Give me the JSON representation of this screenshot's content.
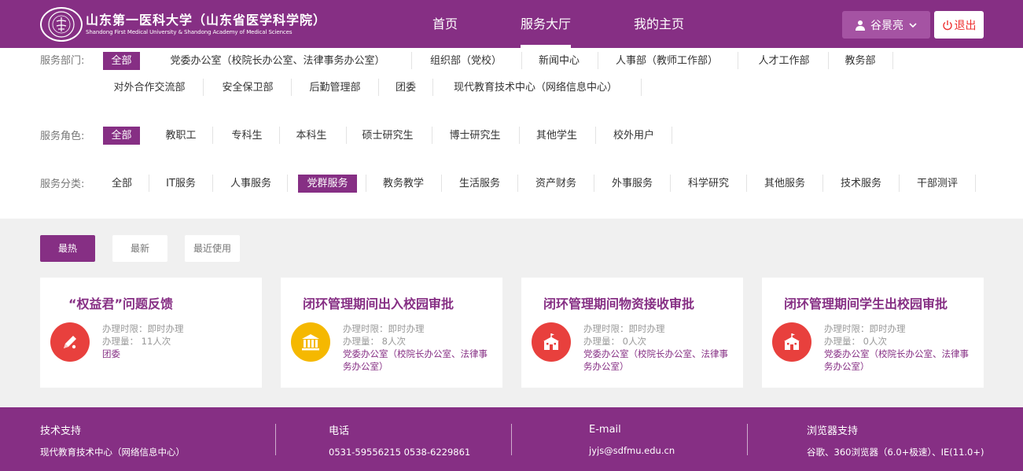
{
  "header": {
    "logo": {
      "cn": "山东第一医科大学（山东省医学科学院）",
      "en": "Shandong First Medical University & Shandong Academy of Medical Sciences"
    },
    "nav": [
      {
        "label": "首页",
        "active": false
      },
      {
        "label": "服务大厅",
        "active": true
      },
      {
        "label": "我的主页",
        "active": false
      }
    ],
    "user_name": "谷景亮",
    "logout_label": "退出"
  },
  "filters": {
    "dept": {
      "label": "服务部门:",
      "items": [
        "全部",
        "党委办公室（校院长办公室、法律事务办公室）",
        "组织部（党校）",
        "新闻中心",
        "人事部（教师工作部）",
        "人才工作部",
        "教务部",
        "对外合作交流部",
        "安全保卫部",
        "后勤管理部",
        "团委",
        "现代教育技术中心（网络信息中心）"
      ],
      "selected": 0
    },
    "role": {
      "label": "服务角色:",
      "items": [
        "全部",
        "教职工",
        "专科生",
        "本科生",
        "硕士研究生",
        "博士研究生",
        "其他学生",
        "校外用户"
      ],
      "selected": 0
    },
    "category": {
      "label": "服务分类:",
      "items": [
        "全部",
        "IT服务",
        "人事服务",
        "党群服务",
        "教务教学",
        "生活服务",
        "资产财务",
        "外事服务",
        "科学研究",
        "其他服务",
        "技术服务",
        "干部测评"
      ],
      "selected": 3
    }
  },
  "tabs": [
    {
      "label": "最热",
      "selected": true
    },
    {
      "label": "最新",
      "selected": false
    },
    {
      "label": "最近使用",
      "selected": false
    }
  ],
  "cards": [
    {
      "title": "“权益君”问题反馈",
      "limit": "办理时限：即时办理",
      "count": "办理量： 11人次",
      "dept": "团委",
      "icon": "pen-icon",
      "icon_color": "#e8403d"
    },
    {
      "title": "闭环管理期间出入校园审批",
      "limit": "办理时限：即时办理",
      "count": "办理量： 8人次",
      "dept": "党委办公室（校院长办公室、法律事务办公室）",
      "icon": "institution-icon",
      "icon_color": "#f5b800"
    },
    {
      "title": "闭环管理期间物资接收审批",
      "limit": "办理时限：即时办理",
      "count": "办理量： 0人次",
      "dept": "党委办公室（校院长办公室、法律事务办公室）",
      "icon": "school-icon",
      "icon_color": "#e8403d"
    },
    {
      "title": "闭环管理期间学生出校园审批",
      "limit": "办理时限：即时办理",
      "count": "办理量： 0人次",
      "dept": "党委办公室（校院长办公室、法律事务办公室）",
      "icon": "school-icon",
      "icon_color": "#e8403d"
    }
  ],
  "footer": [
    {
      "title": "技术支持",
      "value": "现代教育技术中心（网络信息中心）"
    },
    {
      "title": "电话",
      "value": "0531-59556215 0538-6229861"
    },
    {
      "title": "E-mail",
      "value": "jyjs@sdfmu.edu.cn"
    },
    {
      "title": "浏览器支持",
      "value": "谷歌、360浏览器（6.0+极速）、IE(11.0+)"
    }
  ],
  "colors": {
    "brand": "#862f84",
    "danger": "#e33333"
  }
}
